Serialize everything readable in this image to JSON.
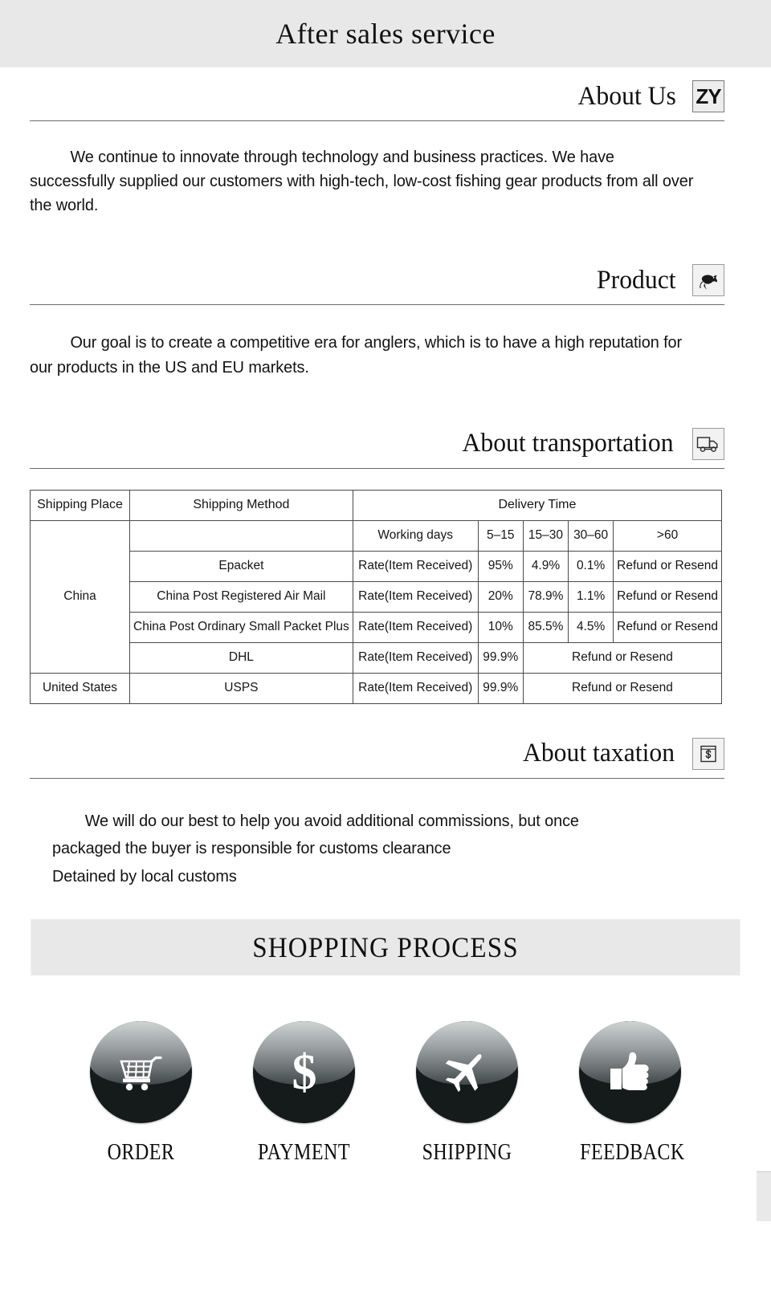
{
  "banner": {
    "top_title": "After sales service",
    "shopping_title": "SHOPPING PROCESS"
  },
  "sections": {
    "about_us": {
      "title": "About Us",
      "icon_text": "ZY",
      "icon_name": "zy-logo-icon",
      "paragraph": "We continue to innovate through technology and business practices. We have successfully supplied our customers with high-tech, low-cost fishing gear products from all over the world."
    },
    "product": {
      "title": "Product",
      "icon_name": "fish-icon",
      "paragraph": "Our goal is to create a competitive era for anglers, which is to have a high reputation for our products in the US and EU markets."
    },
    "transportation": {
      "title": "About transportation",
      "icon_name": "delivery-truck-icon"
    },
    "taxation": {
      "title": "About taxation",
      "icon_name": "banknote-dollar-icon",
      "line1": "We will do our best to help you avoid additional commissions, but once",
      "line2": "packaged the buyer is responsible for customs clearance",
      "line3": "Detained by local customs"
    }
  },
  "shipping_table": {
    "headers": {
      "shipping_place": "Shipping Place",
      "shipping_method": "Shipping Method",
      "delivery_time": "Delivery Time"
    },
    "subheaders": {
      "working_days": "Working days",
      "r1": "5–15",
      "r2": "15–30",
      "r3": "30–60",
      "r4": ">60"
    },
    "rows": [
      {
        "place": "China",
        "method": "Epacket",
        "rate_label": "Rate(Item Received)",
        "v1": "95%",
        "v2": "4.9%",
        "v3": "0.1%",
        "v4": "Refund or Resend"
      },
      {
        "place": "",
        "method": "China Post Registered Air Mail",
        "rate_label": "Rate(Item Received)",
        "v1": "20%",
        "v2": "78.9%",
        "v3": "1.1%",
        "v4": "Refund or Resend"
      },
      {
        "place": "",
        "method": "China Post Ordinary Small Packet Plus",
        "rate_label": "Rate(Item Received)",
        "v1": "10%",
        "v2": "85.5%",
        "v3": "4.5%",
        "v4": "Refund or Resend"
      },
      {
        "place": "",
        "method": "DHL",
        "rate_label": "Rate(Item Received)",
        "v1": "99.9%",
        "v_merged": "Refund or Resend"
      },
      {
        "place": "United States",
        "method": "USPS",
        "rate_label": "Rate(Item Received)",
        "v1": "99.9%",
        "v_merged": "Refund or Resend"
      }
    ]
  },
  "process": {
    "steps": [
      {
        "label": "ORDER",
        "icon_name": "shopping-cart-icon"
      },
      {
        "label": "PAYMENT",
        "icon_name": "dollar-sign-icon"
      },
      {
        "label": "SHIPPING",
        "icon_name": "airplane-icon"
      },
      {
        "label": "FEEDBACK",
        "icon_name": "thumbs-up-icon"
      }
    ]
  },
  "colors": {
    "banner_bg": "#e8e8e8",
    "text": "#111111",
    "rule": "#6a6a6a",
    "table_border": "#4a4a4a",
    "icon_circle": "#151b1a"
  }
}
